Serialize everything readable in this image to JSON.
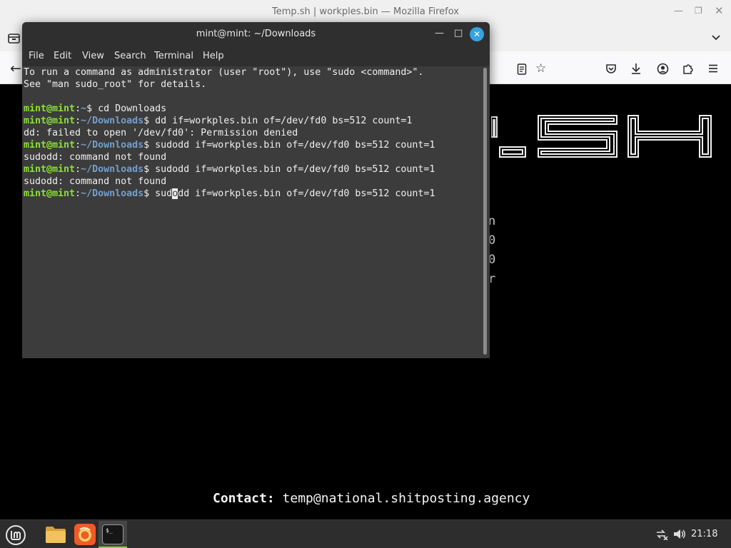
{
  "firefox": {
    "title": "Temp.sh | workples.bin — Mozilla Firefox",
    "page": {
      "side_chars": [
        "n",
        "0",
        "0",
        "r"
      ],
      "contact_label": "Contact:",
      "contact_email": "temp@national.shitposting.agency"
    }
  },
  "terminal": {
    "title": "mint@mint: ~/Downloads",
    "menu": [
      "File",
      "Edit",
      "View",
      "Search",
      "Terminal",
      "Help"
    ],
    "prompt_user": "mint@mint",
    "lines": [
      "To run a command as administrator (user \"root\"), use \"sudo <command>\".",
      "See \"man sudo_root\" for details.",
      "",
      "dd: failed to open '/dev/fd0': Permission denied",
      "sudodd: command not found",
      "sudodd: command not found"
    ],
    "commands": [
      {
        "path": "~",
        "cmd": "cd Downloads"
      },
      {
        "path": "~/Downloads",
        "cmd": "dd if=workples.bin of=/dev/fd0 bs=512 count=1"
      },
      {
        "path": "~/Downloads",
        "cmd": "sudodd if=workples.bin of=/dev/fd0 bs=512 count=1"
      },
      {
        "path": "~/Downloads",
        "cmd": "sudodd if=workples.bin of=/dev/fd0 bs=512 count=1"
      },
      {
        "path": "~/Downloads",
        "cmd_before_cursor": "sud",
        "cursor_char": "o",
        "cmd_after_cursor": "dd if=workples.bin of=/dev/fd0 bs=512 count=1"
      }
    ]
  },
  "taskbar": {
    "clock": "21:18"
  },
  "colors": {
    "prompt_user": "#8ae234",
    "prompt_path": "#729fcf",
    "terminal_bg": "#3c3c3c",
    "close_button": "#35a3e0",
    "firefox_icon": "#f05a28",
    "folder_icon": "#e8b54a"
  }
}
